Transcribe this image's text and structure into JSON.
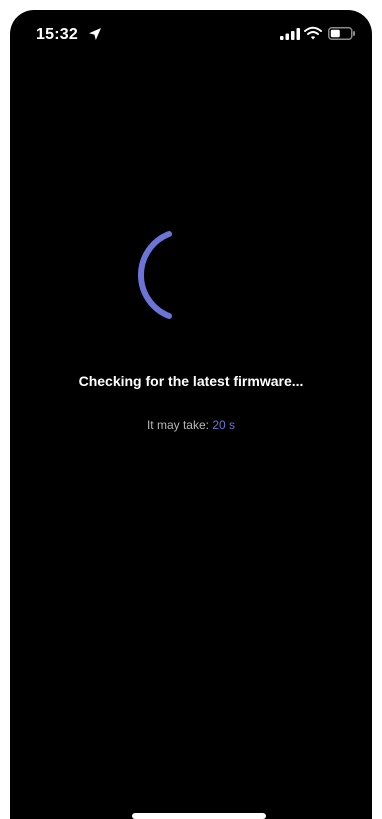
{
  "status_bar": {
    "time": "15:32",
    "icons": [
      "location-arrow-icon",
      "cellular-signal-icon",
      "wifi-icon",
      "battery-icon"
    ]
  },
  "loader": {
    "icon": "loading-spinner-icon",
    "accent_color": "#6c74d8"
  },
  "message": "Checking for the latest firmware...",
  "eta": {
    "label": "It may take:",
    "value": "20 s"
  },
  "colors": {
    "background": "#000000",
    "text": "#ffffff",
    "muted": "#b8b8b8",
    "accent": "#6c74d8"
  }
}
